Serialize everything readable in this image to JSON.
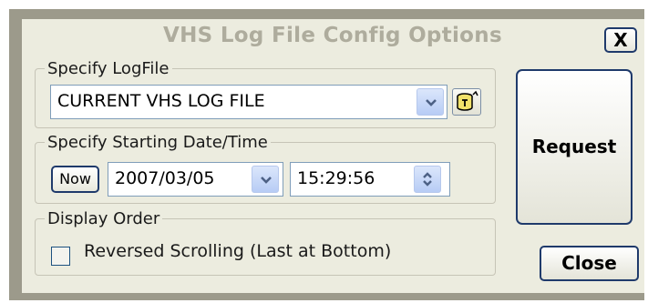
{
  "dialog": {
    "title": "VHS Log File Config Options",
    "close_x_label": "X"
  },
  "logfile": {
    "legend": "Specify LogFile",
    "selected_value": "CURRENT VHS LOG FILE"
  },
  "start": {
    "legend": "Specify Starting Date/Time",
    "now_label": "Now",
    "date_value": "2007/03/05",
    "time_value": "15:29:56"
  },
  "order": {
    "legend": "Display Order",
    "reversed_label": "Reversed Scrolling (Last at Bottom)",
    "reversed_checked": false
  },
  "actions": {
    "request_label": "Request",
    "close_label": "Close"
  },
  "icons": [
    "chevron-down-icon",
    "database-icon",
    "spinner-arrows-icon",
    "close-icon"
  ],
  "colors": {
    "frame": "#9c9a8b",
    "panel": "#ececdf",
    "title_text": "#aeac9d",
    "button_border": "#1f3a6b",
    "dropdown_arrow": "#4d6185"
  }
}
